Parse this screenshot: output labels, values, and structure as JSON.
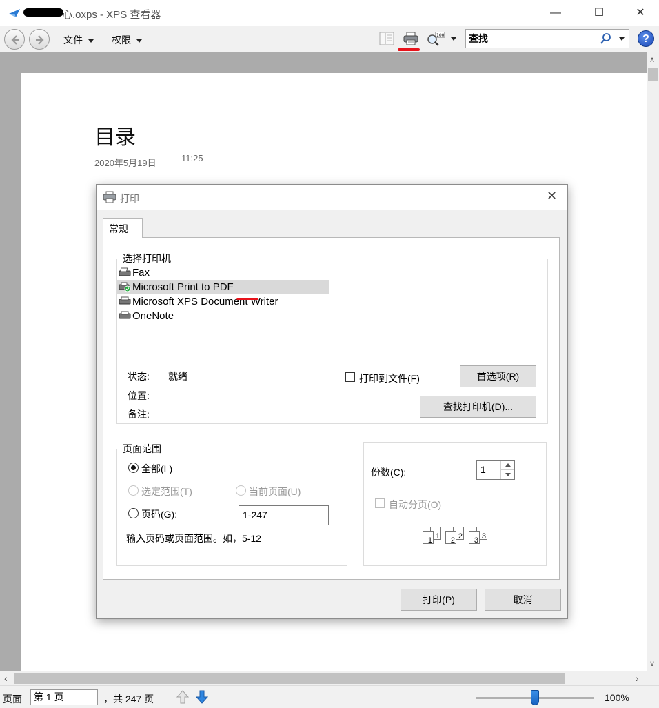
{
  "window": {
    "title_suffix": "心.oxps - XPS 查看器",
    "minimize": "—",
    "maximize": "☐",
    "close": "✕"
  },
  "toolbar": {
    "menu_file": "文件",
    "menu_permissions": "权限",
    "search_value": "查找",
    "help": "?"
  },
  "document": {
    "heading": "目录",
    "date": "2020年5月19日",
    "time": "11:25"
  },
  "print_dialog": {
    "title": "打印",
    "close": "✕",
    "tab_general": "常规",
    "select_printer_legend": "选择打印机",
    "printers": [
      {
        "name": "Fax",
        "selected": false,
        "default": false
      },
      {
        "name": "Microsoft Print to PDF",
        "selected": true,
        "default": true
      },
      {
        "name": "Microsoft XPS Document Writer",
        "selected": false,
        "default": false
      },
      {
        "name": "OneNote",
        "selected": false,
        "default": false
      }
    ],
    "status_label": "状态:",
    "status_value": "就绪",
    "location_label": "位置:",
    "comment_label": "备注:",
    "print_to_file": "打印到文件(F)",
    "print_to_file_checked": false,
    "preferences_button": "首选项(R)",
    "find_printer_button": "查找打印机(D)...",
    "page_range_legend": "页面范围",
    "range_all": "全部(L)",
    "range_selection": "选定范围(T)",
    "range_current": "当前页面(U)",
    "range_pages": "页码(G):",
    "range_selected": "all",
    "pages_value": "1-247",
    "range_hint": "输入页码或页面范围。如，5-12",
    "copies_label": "份数(C):",
    "copies_value": "1",
    "collate_label": "自动分页(O)",
    "collate_checked": false,
    "collate_pages": [
      "1",
      "1",
      "2",
      "2",
      "3",
      "3"
    ],
    "print_button": "打印(P)",
    "cancel_button": "取消"
  },
  "statusbar": {
    "page_label": "页面",
    "page_value": "第 1 页",
    "total_pages": "，共 247 页",
    "zoom": "100%",
    "zoom_slider_fraction": 0.5
  },
  "colors": {
    "annotation_red": "#e8131b",
    "doc_background": "#ababab",
    "dialog_background": "#f0f0f0",
    "help_blue": "#1b48b8",
    "zoom_thumb_blue": "#1863c2"
  }
}
